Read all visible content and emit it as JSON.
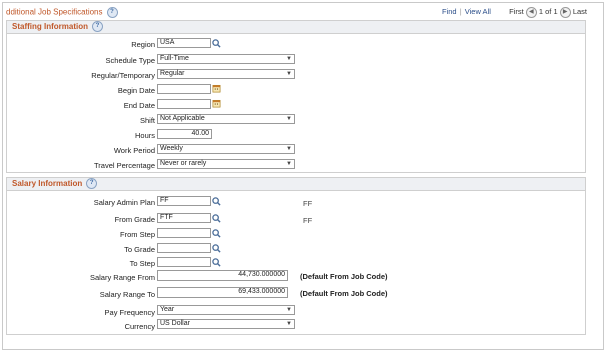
{
  "header": {
    "title": "dditional Job Specifications",
    "find_label": "Find",
    "viewall_label": "View All",
    "first_label": "First",
    "page_status": "1 of 1",
    "last_label": "Last"
  },
  "staffing": {
    "title": "Staffing Information",
    "region_label": "Region",
    "region_value": "USA",
    "schedule_type_label": "Schedule Type",
    "schedule_type_value": "Full-Time",
    "regular_temp_label": "Regular/Temporary",
    "regular_temp_value": "Regular",
    "begin_date_label": "Begin Date",
    "begin_date_value": "",
    "end_date_label": "End Date",
    "end_date_value": "",
    "shift_label": "Shift",
    "shift_value": "Not Applicable",
    "hours_label": "Hours",
    "hours_value": "40.00",
    "work_period_label": "Work Period",
    "work_period_value": "Weekly",
    "travel_label": "Travel Percentage",
    "travel_value": "Never or rarely"
  },
  "salary": {
    "title": "Salary Information",
    "admin_plan_label": "Salary Admin Plan",
    "admin_plan_value": "FF",
    "admin_plan_desc": "FF",
    "from_grade_label": "From Grade",
    "from_grade_value": "FTF",
    "from_grade_desc": "FF",
    "from_step_label": "From Step",
    "from_step_value": "",
    "to_grade_label": "To Grade",
    "to_grade_value": "",
    "to_step_label": "To Step",
    "to_step_value": "",
    "range_from_label": "Salary Range From",
    "range_from_value": "44,730.000000",
    "range_from_note": "(Default From Job Code)",
    "range_to_label": "Salary Range To",
    "range_to_value": "69,433.000000",
    "range_to_note": "(Default From Job Code)",
    "pay_freq_label": "Pay Frequency",
    "pay_freq_value": "Year",
    "currency_label": "Currency",
    "currency_value": "US Dollar"
  },
  "icons": {
    "help": "question-circle-icon",
    "lookup": "magnifier-icon",
    "calendar": "calendar-icon",
    "dropdown": "chevron-down-icon"
  },
  "colors": {
    "section_title": "#c0582a",
    "link": "#2c4f8a"
  }
}
